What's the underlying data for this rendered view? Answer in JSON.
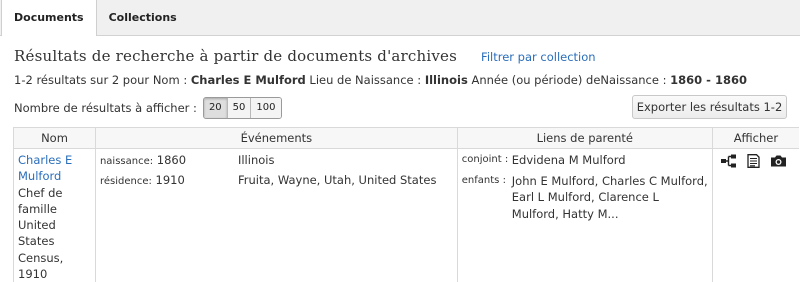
{
  "tabs": [
    {
      "label": "Documents",
      "active": true
    },
    {
      "label": "Collections",
      "active": false
    }
  ],
  "page_title": "Résultats de recherche à partir de documents d'archives",
  "filter_link": "Filtrer par collection",
  "summary": {
    "prefix": "1-2 résultats sur 2 pour Nom : ",
    "name": "Charles E Mulford",
    "birthplace_label": " Lieu de Naissance : ",
    "birthplace": "Illinois",
    "year_label": " Année (ou période) deNaissance : ",
    "year_range": "1860 - 1860"
  },
  "per_page": {
    "label": "Nombre de résultats à afficher :",
    "options": [
      "20",
      "50",
      "100"
    ],
    "selected": "20"
  },
  "export_button": "Exporter les résultats 1-2",
  "table": {
    "headers": [
      "Nom",
      "Événements",
      "Liens de parenté",
      "Afficher"
    ],
    "rows": [
      {
        "name_link": "Charles E Mulford",
        "role": "Chef de famille",
        "collection": "United States Census, 1910",
        "events": [
          {
            "type": "naissance:",
            "date": "1860",
            "place": "Illinois"
          },
          {
            "type": "résidence:",
            "date": "1910",
            "place": "Fruita, Wayne, Utah, United States"
          }
        ],
        "relations": [
          {
            "type": "conjoint :",
            "names": "Edvidena M Mulford"
          },
          {
            "type": "enfants :",
            "names": "John E Mulford, Charles C Mulford, Earl L Mulford, Clarence L Mulford, Hatty M..."
          }
        ],
        "view_icons": [
          "family-tree-icon",
          "document-icon",
          "camera-icon"
        ]
      }
    ]
  },
  "colors": {
    "link": "#2a6ebb",
    "tab_bar": "#f0f0f0",
    "border": "#d9d9d9"
  }
}
